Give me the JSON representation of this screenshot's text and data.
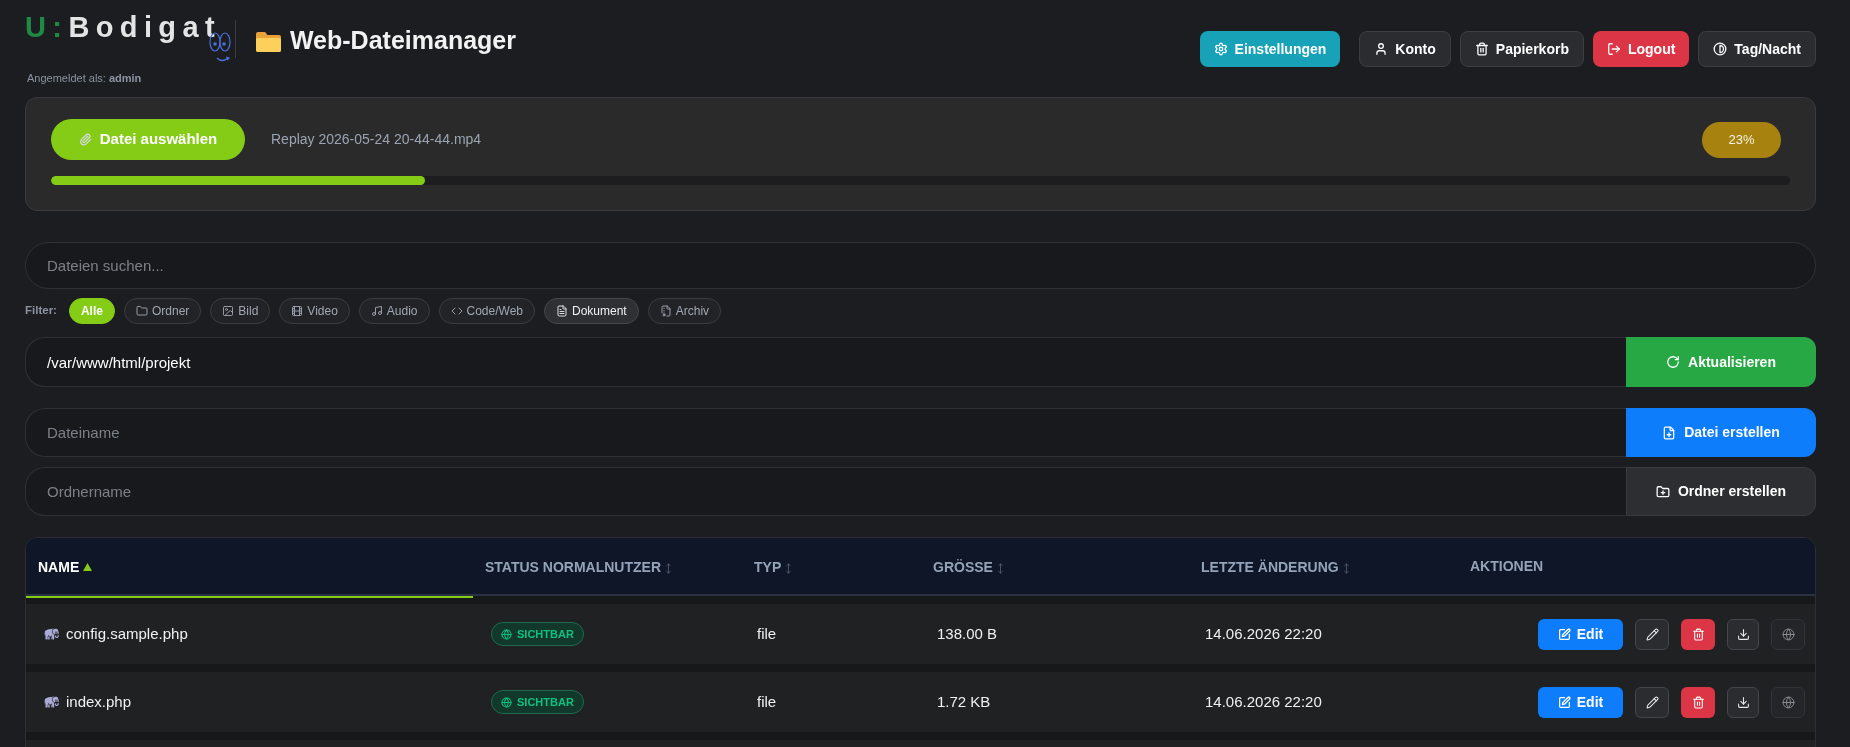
{
  "header": {
    "logo": {
      "prefix": "U:",
      "name": "Bodigat"
    },
    "title": "Web-Dateimanager",
    "login_info": "Angemeldet als: **admin**",
    "buttons": [
      {
        "label": "Einstellungen",
        "kind": "info"
      },
      {
        "label": "Konto",
        "kind": "secondary"
      },
      {
        "label": "Papierkorb",
        "kind": "secondary"
      },
      {
        "label": "Logout",
        "kind": "danger"
      },
      {
        "label": "Tag/Nacht",
        "kind": "secondary"
      }
    ]
  },
  "upload": {
    "button": "Datei auswählen",
    "file_name": "Replay 2026-05-24 20-44-44.mp4",
    "progress": {
      "level": 0.215,
      "reading": "23%"
    }
  },
  "search": {
    "placeholder": "Dateien suchen..."
  },
  "filter": {
    "label": "Filter:",
    "chips": [
      {
        "label": "Alle",
        "selected": true,
        "highlighted": false
      },
      {
        "label": "Ordner",
        "selected": false,
        "highlighted": false
      },
      {
        "label": "Bild",
        "selected": false,
        "highlighted": false
      },
      {
        "label": "Video",
        "selected": false,
        "highlighted": false
      },
      {
        "label": "Audio",
        "selected": false,
        "highlighted": false
      },
      {
        "label": "Code/Web",
        "selected": false,
        "highlighted": false
      },
      {
        "label": "Dokument",
        "selected": false,
        "highlighted": true
      },
      {
        "label": "Archiv",
        "selected": false,
        "highlighted": false
      }
    ]
  },
  "path_bar": {
    "value": "/var/www/html/projekt",
    "button": "Aktualisieren"
  },
  "create_file": {
    "placeholder": "Dateiname",
    "button": "Datei erstellen"
  },
  "create_folder": {
    "placeholder": "Ordnername",
    "button": "Ordner erstellen"
  },
  "table": {
    "columns": [
      {
        "label": "NAME",
        "sortable": true,
        "sorted": true
      },
      {
        "label": "STATUS NORMALNUTZER",
        "sortable": true,
        "sorted": false
      },
      {
        "label": "TYP",
        "sortable": true,
        "sorted": false
      },
      {
        "label": "GRÖSSE",
        "sortable": true,
        "sorted": false
      },
      {
        "label": "LETZTE ÄNDERUNG",
        "sortable": true,
        "sorted": false
      },
      {
        "label": "AKTIONEN",
        "sortable": false,
        "sorted": false
      }
    ],
    "rows": [
      {
        "name": "config.sample.php",
        "status": "SICHTBAR",
        "type": "file",
        "size": "138.00 B",
        "modified": "14.06.2026 22:20",
        "edit_label": "Edit"
      },
      {
        "name": "index.php",
        "status": "SICHTBAR",
        "type": "file",
        "size": "1.72 KB",
        "modified": "14.06.2026 22:20",
        "edit_label": "Edit"
      }
    ]
  }
}
